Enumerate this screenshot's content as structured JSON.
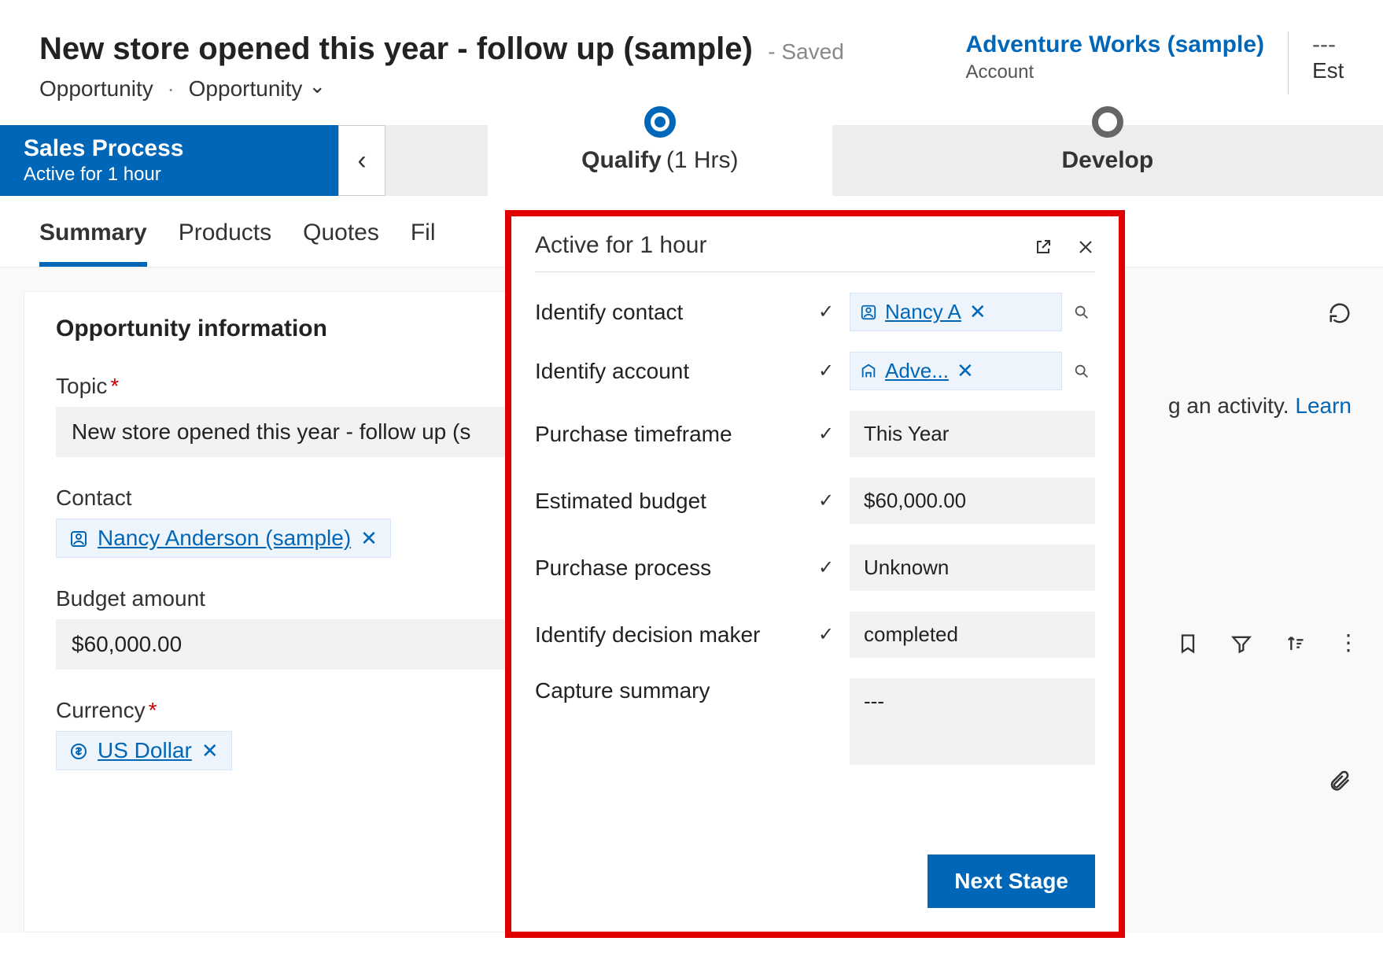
{
  "header": {
    "title": "New store opened this year - follow up (sample)",
    "save_status": "- Saved",
    "entity_type": "Opportunity",
    "form_name": "Opportunity",
    "account_link": "Adventure Works (sample)",
    "account_label": "Account",
    "est_label": "Est",
    "est_value": "---"
  },
  "process": {
    "name": "Sales Process",
    "duration": "Active for 1 hour",
    "stages": [
      {
        "label": "Qualify",
        "hours": "(1 Hrs)",
        "state": "current"
      },
      {
        "label": "Develop",
        "hours": "",
        "state": "future"
      }
    ]
  },
  "tabs": [
    "Summary",
    "Products",
    "Quotes",
    "Fil"
  ],
  "active_tab": "Summary",
  "opportunity": {
    "section_title": "Opportunity information",
    "topic_label": "Topic",
    "topic_value": "New store opened this year - follow up (s",
    "contact_label": "Contact",
    "contact_value": "Nancy Anderson (sample)",
    "budget_label": "Budget amount",
    "budget_value": "$60,000.00",
    "currency_label": "Currency",
    "currency_value": "US Dollar"
  },
  "right": {
    "hint_suffix": " an activity. ",
    "hint_prefix_char": "g",
    "learn_link": "Learn"
  },
  "flyout": {
    "title": "Active for 1 hour",
    "rows": [
      {
        "label": "Identify contact",
        "checked": true,
        "type": "lookup",
        "value": "Nancy A"
      },
      {
        "label": "Identify account",
        "checked": true,
        "type": "lookup_acct",
        "value": "Adve..."
      },
      {
        "label": "Purchase timeframe",
        "checked": true,
        "type": "text",
        "value": "This Year"
      },
      {
        "label": "Estimated budget",
        "checked": true,
        "type": "text",
        "value": "$60,000.00"
      },
      {
        "label": "Purchase process",
        "checked": true,
        "type": "text",
        "value": "Unknown"
      },
      {
        "label": "Identify decision maker",
        "checked": true,
        "type": "text",
        "value": "completed"
      },
      {
        "label": "Capture summary",
        "checked": false,
        "type": "textarea",
        "value": "---"
      }
    ],
    "next_button": "Next Stage"
  }
}
